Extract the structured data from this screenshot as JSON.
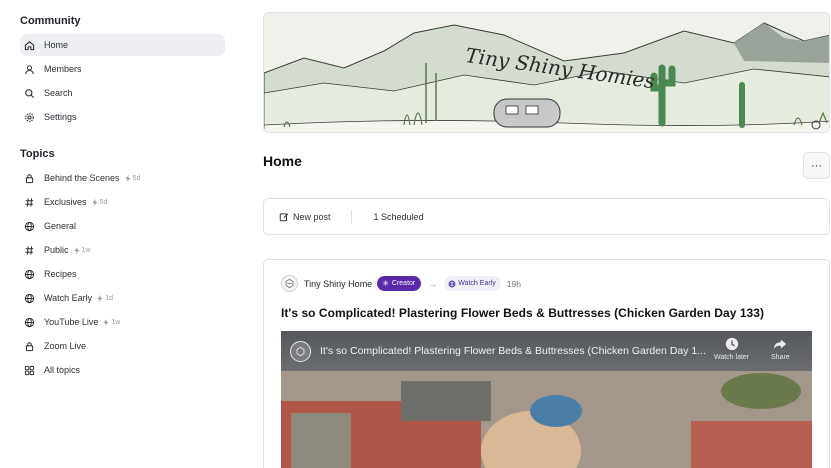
{
  "sidebar": {
    "community_title": "Community",
    "community_items": [
      {
        "label": "Home",
        "icon": "home-icon"
      },
      {
        "label": "Members",
        "icon": "person-icon"
      },
      {
        "label": "Search",
        "icon": "search-icon"
      },
      {
        "label": "Settings",
        "icon": "gear-icon"
      }
    ],
    "topics_title": "Topics",
    "topic_items": [
      {
        "label": "Behind the Scenes",
        "icon": "lock-icon",
        "meta": "5d"
      },
      {
        "label": "Exclusives",
        "icon": "hash-icon",
        "meta": "5d"
      },
      {
        "label": "General",
        "icon": "globe-icon",
        "meta": ""
      },
      {
        "label": "Public",
        "icon": "hash-icon",
        "meta": "1w"
      },
      {
        "label": "Recipes",
        "icon": "globe-icon",
        "meta": ""
      },
      {
        "label": "Watch Early",
        "icon": "globe-icon",
        "meta": "1d"
      },
      {
        "label": "YouTube Live",
        "icon": "globe-icon",
        "meta": "1w"
      },
      {
        "label": "Zoom Live",
        "icon": "lock-icon",
        "meta": ""
      },
      {
        "label": "All topics",
        "icon": "grid-icon",
        "meta": ""
      }
    ]
  },
  "banner": {
    "text": "Tiny Shiny Homies"
  },
  "main": {
    "page_title": "Home",
    "more_label": "···",
    "new_post_label": "New post",
    "scheduled_label": "1 Scheduled"
  },
  "post": {
    "author": "Tiny Shiny Home",
    "badge": "Creator",
    "arrow": "→",
    "topic": "Watch Early",
    "time": "19h",
    "title": "It's so Complicated! Plastering Flower Beds & Buttresses (Chicken Garden Day 133)",
    "video_title": "It's so Complicated! Plastering Flower Beds & Buttresses (Chicken Garden Day 1...",
    "watch_later_label": "Watch later",
    "share_label": "Share"
  },
  "colors": {
    "accent": "#5a2aa8",
    "active_bg": "#eeeff2",
    "border": "#dfe2e6"
  }
}
